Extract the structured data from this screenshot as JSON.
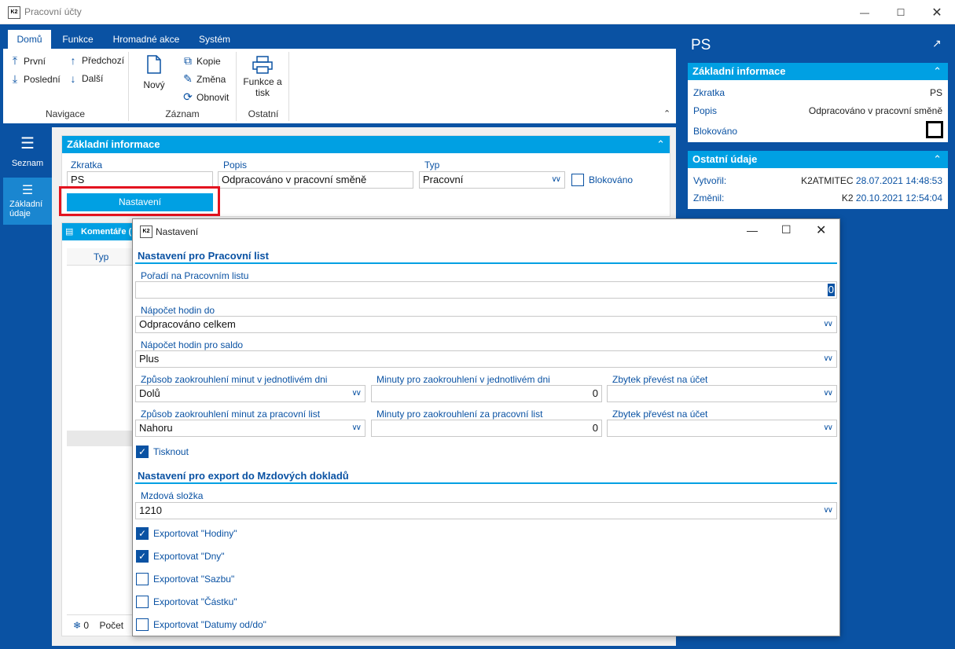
{
  "window": {
    "title": "Pracovní účty"
  },
  "ribbon": {
    "tabs": [
      "Domů",
      "Funkce",
      "Hromadné akce",
      "Systém"
    ],
    "nav": {
      "first": "První",
      "last": "Poslední",
      "prev": "Předchozí",
      "next": "Další",
      "group": "Navigace"
    },
    "record": {
      "new": "Nový",
      "copy": "Kopie",
      "change": "Změna",
      "refresh": "Obnovit",
      "group": "Záznam"
    },
    "other": {
      "print": "Funkce a tisk",
      "group": "Ostatní"
    }
  },
  "leftnav": {
    "list": "Seznam",
    "basic": "Základní údaje"
  },
  "form": {
    "section": "Základní informace",
    "zkratka_label": "Zkratka",
    "zkratka": "PS",
    "popis_label": "Popis",
    "popis": "Odpracováno v pracovní směně",
    "typ_label": "Typ",
    "typ": "Pracovní",
    "blokovano": "Blokováno",
    "settings_button": "Nastavení"
  },
  "comments": {
    "title": "Komentáře (",
    "col": "Typ",
    "count": "0",
    "footer": "Počet"
  },
  "right": {
    "title": "PS",
    "basic": "Základní informace",
    "zkratka_label": "Zkratka",
    "zkratka": "PS",
    "popis_label": "Popis",
    "popis": "Odpracováno v pracovní směně",
    "blok_label": "Blokováno",
    "other": "Ostatní údaje",
    "created_label": "Vytvořil:",
    "created_user": "K2ATMITEC",
    "created_date": "28.07.2021 14:48:53",
    "changed_label": "Změnil:",
    "changed_user": "K2",
    "changed_date": "20.10.2021 12:54:04"
  },
  "dialog": {
    "title": "Nastavení",
    "sec1": "Nastavení pro Pracovní list",
    "poradi_label": "Pořadí na Pracovním listu",
    "poradi": "0",
    "napocet_label": "Nápočet hodin do",
    "napocet": "Odpracováno celkem",
    "saldo_label": "Nápočet hodin pro saldo",
    "saldo": "Plus",
    "zp_den_label": "Způsob zaokrouhlení minut v jednotlivém dni",
    "zp_den": "Dolů",
    "min_den_label": "Minuty pro zaokrouhlení v jednotlivém dni",
    "min_den": "0",
    "zb_den_label": "Zbytek převést na účet",
    "zb_den": "",
    "zp_list_label": "Způsob zaokrouhlení minut za pracovní list",
    "zp_list": "Nahoru",
    "min_list_label": "Minuty pro zaokrouhlení za pracovní list",
    "min_list": "0",
    "zb_list_label": "Zbytek převést na účet",
    "zb_list": "",
    "tisknout": "Tisknout",
    "sec2": "Nastavení pro export do Mzdových dokladů",
    "mzd_label": "Mzdová složka",
    "mzd": "1210",
    "exp_hodiny": "Exportovat \"Hodiny\"",
    "exp_dny": "Exportovat \"Dny\"",
    "exp_sazbu": "Exportovat \"Sazbu\"",
    "exp_castku": "Exportovat \"Částku\"",
    "exp_datumy": "Exportovat \"Datumy od/do\""
  }
}
